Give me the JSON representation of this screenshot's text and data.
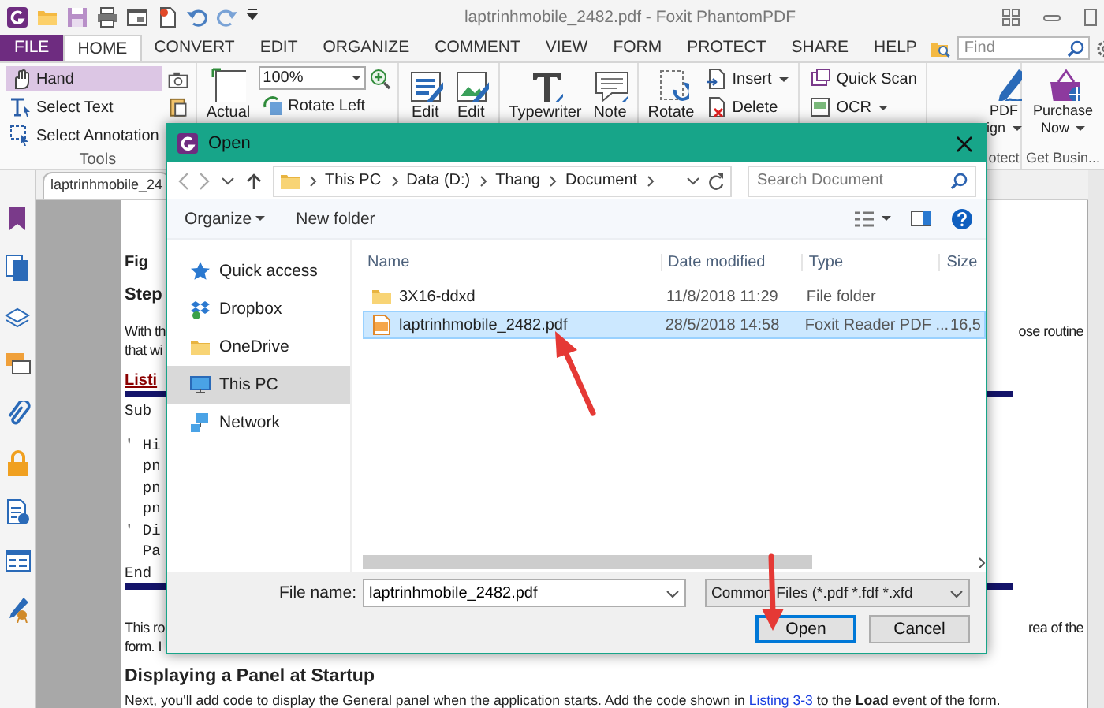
{
  "window": {
    "title": "laptrinhmobile_2482.pdf - Foxit PhantomPDF"
  },
  "menu_tabs": [
    {
      "label": "FILE",
      "kind": "file",
      "selected": false
    },
    {
      "label": "HOME",
      "kind": "tab",
      "selected": true
    },
    {
      "label": "CONVERT",
      "kind": "tab",
      "selected": false
    },
    {
      "label": "EDIT",
      "kind": "tab",
      "selected": false
    },
    {
      "label": "ORGANIZE",
      "kind": "tab",
      "selected": false
    },
    {
      "label": "COMMENT",
      "kind": "tab",
      "selected": false
    },
    {
      "label": "VIEW",
      "kind": "tab",
      "selected": false
    },
    {
      "label": "FORM",
      "kind": "tab",
      "selected": false
    },
    {
      "label": "PROTECT",
      "kind": "tab",
      "selected": false
    },
    {
      "label": "SHARE",
      "kind": "tab",
      "selected": false
    },
    {
      "label": "HELP",
      "kind": "tab",
      "selected": false
    }
  ],
  "find": {
    "placeholder": "Find"
  },
  "ribbon": {
    "groups": [
      {
        "kind": "tools",
        "label": "Tools",
        "items": [
          {
            "kind": "small",
            "label": "Hand",
            "selected": true
          },
          {
            "kind": "small",
            "label": "Select Text",
            "selected": false
          },
          {
            "kind": "small",
            "label": "Select Annotation",
            "selected": false
          }
        ]
      },
      {
        "kind": "view",
        "items": [
          {
            "kind": "large",
            "label": "Actual"
          },
          {
            "kind": "combo",
            "label": "100%"
          },
          {
            "kind": "small",
            "label": "Rotate Left"
          }
        ]
      },
      {
        "kind": "edit",
        "items": [
          {
            "kind": "large",
            "label": "Edit"
          },
          {
            "kind": "large",
            "label": "Edit"
          }
        ]
      },
      {
        "kind": "comment",
        "items": [
          {
            "kind": "large",
            "label": "Typewriter"
          },
          {
            "kind": "large",
            "label": "Note"
          }
        ]
      },
      {
        "kind": "pages",
        "items": [
          {
            "kind": "large",
            "label": "Rotate"
          },
          {
            "kind": "small",
            "label": "Insert",
            "dropdown": true
          },
          {
            "kind": "small",
            "label": "Delete"
          }
        ]
      },
      {
        "kind": "scan",
        "items": [
          {
            "kind": "small",
            "label": "Quick Scan"
          },
          {
            "kind": "small",
            "label": "OCR",
            "dropdown": true
          }
        ]
      },
      {
        "kind": "protect",
        "label": "otect",
        "items": [
          {
            "kind": "large",
            "label": "PDF",
            "sublabel": "ign",
            "dropdown": true
          }
        ]
      },
      {
        "kind": "business",
        "label": "Get Busin...",
        "items": [
          {
            "kind": "large",
            "label": "Purchase",
            "sublabel": "Now",
            "dropdown": true
          }
        ]
      }
    ]
  },
  "document": {
    "tab": "laptrinhmobile_24",
    "lines": [
      {
        "kind": "caption",
        "left": "Fig"
      },
      {
        "kind": "step",
        "left": "Step"
      },
      {
        "kind": "para",
        "left": "With th",
        "right": "ose routine"
      },
      {
        "kind": "para",
        "left": "that wi"
      },
      {
        "kind": "listing",
        "left": "Listi"
      },
      {
        "kind": "rule"
      },
      {
        "kind": "code",
        "left": "Sub"
      },
      {
        "kind": "code",
        "left": "' Hi"
      },
      {
        "kind": "code",
        "left": "  pn"
      },
      {
        "kind": "code",
        "left": "  pn"
      },
      {
        "kind": "code",
        "left": "  pn"
      },
      {
        "kind": "code",
        "left": "' Di"
      },
      {
        "kind": "code",
        "left": "  Pa"
      },
      {
        "kind": "code",
        "left": "End"
      },
      {
        "kind": "rule"
      },
      {
        "kind": "para",
        "left": "This ro",
        "right": "rea of the"
      },
      {
        "kind": "para",
        "left": "form. I"
      },
      {
        "kind": "heading",
        "parts": [
          {
            "text": "Displaying a Panel at Startup"
          }
        ]
      },
      {
        "kind": "body",
        "parts": [
          {
            "text": "Next, you'll add code to display the General panel when the application starts. Add the code shown in "
          },
          {
            "text": "Listing 3-3",
            "kind": "link"
          },
          {
            "text": " to the **Load** event of the form."
          }
        ]
      }
    ]
  },
  "dialog": {
    "title": "Open",
    "path": [
      "This PC",
      "Data (D:)",
      "Thang",
      "Document"
    ],
    "search": {
      "placeholder": "Search Document"
    },
    "toolbar": [
      {
        "label": "Organize",
        "dropdown": true
      },
      {
        "label": "New folder"
      }
    ],
    "nav": [
      {
        "label": "Quick access",
        "selected": false
      },
      {
        "label": "Dropbox",
        "selected": false
      },
      {
        "label": "OneDrive",
        "selected": false
      },
      {
        "label": "This PC",
        "selected": true
      },
      {
        "label": "Network",
        "selected": false
      }
    ],
    "columns": [
      "Name",
      "Date modified",
      "Type",
      "Size"
    ],
    "files": [
      {
        "kind": "folder",
        "name": "3X16-ddxd",
        "date": "11/8/2018 11:29",
        "type": "File folder",
        "selected": false
      },
      {
        "kind": "pdf",
        "name": "laptrinhmobile_2482.pdf",
        "date": "28/5/2018 14:58",
        "type": "Foxit Reader PDF ...",
        "size": "16,5",
        "selected": true
      }
    ],
    "file_name": {
      "label": "File name:",
      "value": "laptrinhmobile_2482.pdf"
    },
    "file_type": "Common Files (*.pdf *.fdf *.xfd",
    "buttons": [
      {
        "label": "Open",
        "kind": "default"
      },
      {
        "label": "Cancel",
        "kind": "normal"
      }
    ]
  }
}
